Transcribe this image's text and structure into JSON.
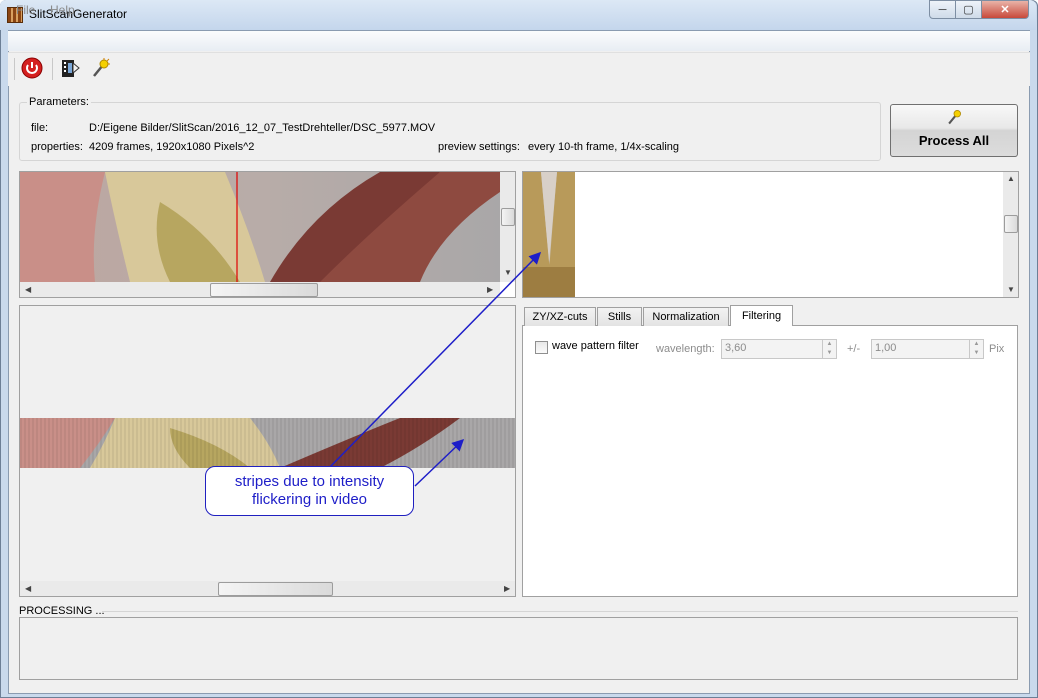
{
  "window": {
    "title": "SlitScanGenerator",
    "controls": {
      "minimize": "─",
      "maximize": "▢",
      "close": "✕"
    }
  },
  "menu": {
    "file": "File",
    "help": "Help"
  },
  "toolbar": {
    "icons": [
      "power-icon",
      "film-open-icon",
      "wand-icon"
    ]
  },
  "parameters": {
    "title": "Parameters:",
    "file_label": "file:",
    "file_value": "D:/Eigene Bilder/SlitScan/2016_12_07_TestDrehteller/DSC_5977.MOV",
    "properties_label": "properties:",
    "properties_value": "4209 frames, 1920x1080 Pixels^2",
    "preview_label": "preview settings:",
    "preview_value": "every 10-th frame, 1/4x-scaling"
  },
  "process_all": {
    "label": "Process All"
  },
  "tabs": [
    {
      "label": "ZY/XZ-cuts"
    },
    {
      "label": "Stills"
    },
    {
      "label": "Normalization"
    },
    {
      "label": "Filtering"
    }
  ],
  "filtering": {
    "checkbox_label": "wave pattern filter",
    "wavelength_label": "wavelength:",
    "wavelength_value": "3,60",
    "tolerance_label": "+/-",
    "tolerance_value": "1,00",
    "unit": "Pix"
  },
  "processing": {
    "label": "PROCESSING ..."
  },
  "annotation": {
    "text": "stripes due to intensity flickering in video"
  },
  "colors": {
    "accent_line": "#e00000",
    "annotation": "#1e1ec8"
  }
}
